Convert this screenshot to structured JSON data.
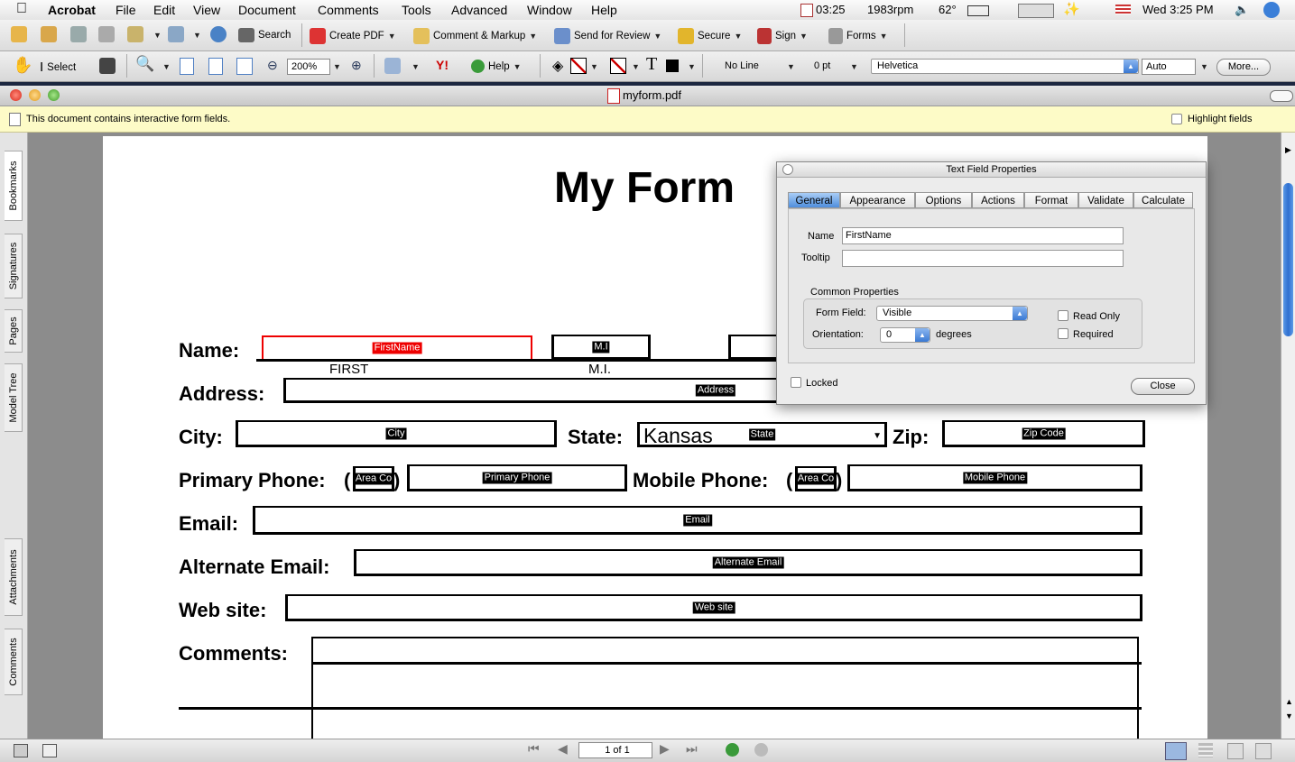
{
  "menubar": {
    "app": "Acrobat",
    "items": [
      "File",
      "Edit",
      "View",
      "Document",
      "Comments",
      "Tools",
      "Advanced",
      "Window",
      "Help"
    ],
    "status": {
      "time_small": "03:25",
      "rpm": "1983rpm",
      "temp": "62°",
      "clock": "Wed 3:25 PM"
    }
  },
  "toolbar1": {
    "search": "Search",
    "create_pdf": "Create PDF",
    "comment_markup": "Comment & Markup",
    "send_review": "Send for Review",
    "secure": "Secure",
    "sign": "Sign",
    "forms": "Forms"
  },
  "toolbar2": {
    "select": "Select",
    "zoom": "200%",
    "help": "Help",
    "line": "No Line",
    "pt": "0 pt",
    "font": "Helvetica",
    "size": "Auto",
    "more": "More..."
  },
  "window": {
    "title": "myform.pdf"
  },
  "message": {
    "text": "This document contains interactive form fields.",
    "highlight": "Highlight fields"
  },
  "sidebar": {
    "tabs": [
      "Bookmarks",
      "Signatures",
      "Pages",
      "Model Tree",
      "Attachments",
      "Comments"
    ]
  },
  "form": {
    "title": "My Form",
    "labels": {
      "name": "Name:",
      "address": "Address:",
      "city": "City:",
      "state": "State:",
      "zip": "Zip:",
      "primary_phone": "Primary Phone:",
      "mobile_phone": "Mobile Phone:",
      "email": "Email:",
      "alt_email": "Alternate Email:",
      "website": "Web site:",
      "comments": "Comments:"
    },
    "sublabels": {
      "first": "FIRST",
      "mi": "M.I."
    },
    "paren_open": "(",
    "paren_close": ")",
    "state_value": "Kansas",
    "fields": {
      "first": "FirstName",
      "mi": "M.I",
      "address": "Address",
      "city": "City",
      "state": "State",
      "zip": "Zip Code",
      "area1": "Area Co",
      "primary": "Primary Phone",
      "area2": "Area Co",
      "mobile": "Mobile Phone",
      "email": "Email",
      "alt_email": "Alternate Email",
      "website": "Web site"
    }
  },
  "dialog": {
    "title": "Text Field Properties",
    "tabs": [
      "General",
      "Appearance",
      "Options",
      "Actions",
      "Format",
      "Validate",
      "Calculate"
    ],
    "name_label": "Name",
    "name_value": "FirstName",
    "tooltip_label": "Tooltip",
    "tooltip_value": "",
    "common": "Common Properties",
    "form_field_label": "Form Field:",
    "form_field_value": "Visible",
    "orientation_label": "Orientation:",
    "orientation_value": "0",
    "degrees": "degrees",
    "read_only": "Read Only",
    "required": "Required",
    "locked": "Locked",
    "close": "Close"
  },
  "statusbar": {
    "page": "1 of 1"
  }
}
